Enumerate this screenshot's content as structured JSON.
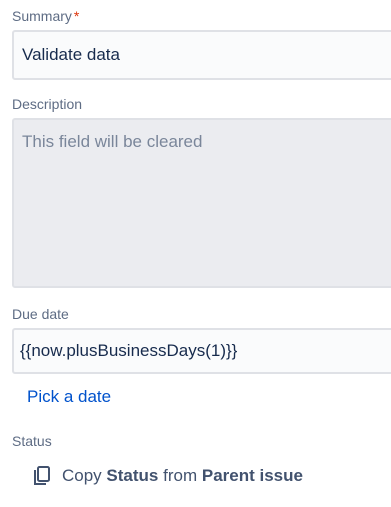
{
  "summary": {
    "label": "Summary",
    "required_mark": "*",
    "value": "Validate data"
  },
  "description": {
    "label": "Description",
    "placeholder": "This field will be cleared"
  },
  "due_date": {
    "label": "Due date",
    "value": "{{now.plusBusinessDays(1)}}",
    "pick_link": "Pick a date"
  },
  "status": {
    "label": "Status",
    "icon": "copy-icon",
    "copy_prefix": "Copy",
    "copy_field": "Status",
    "copy_from": "from",
    "copy_source": "Parent issue"
  }
}
